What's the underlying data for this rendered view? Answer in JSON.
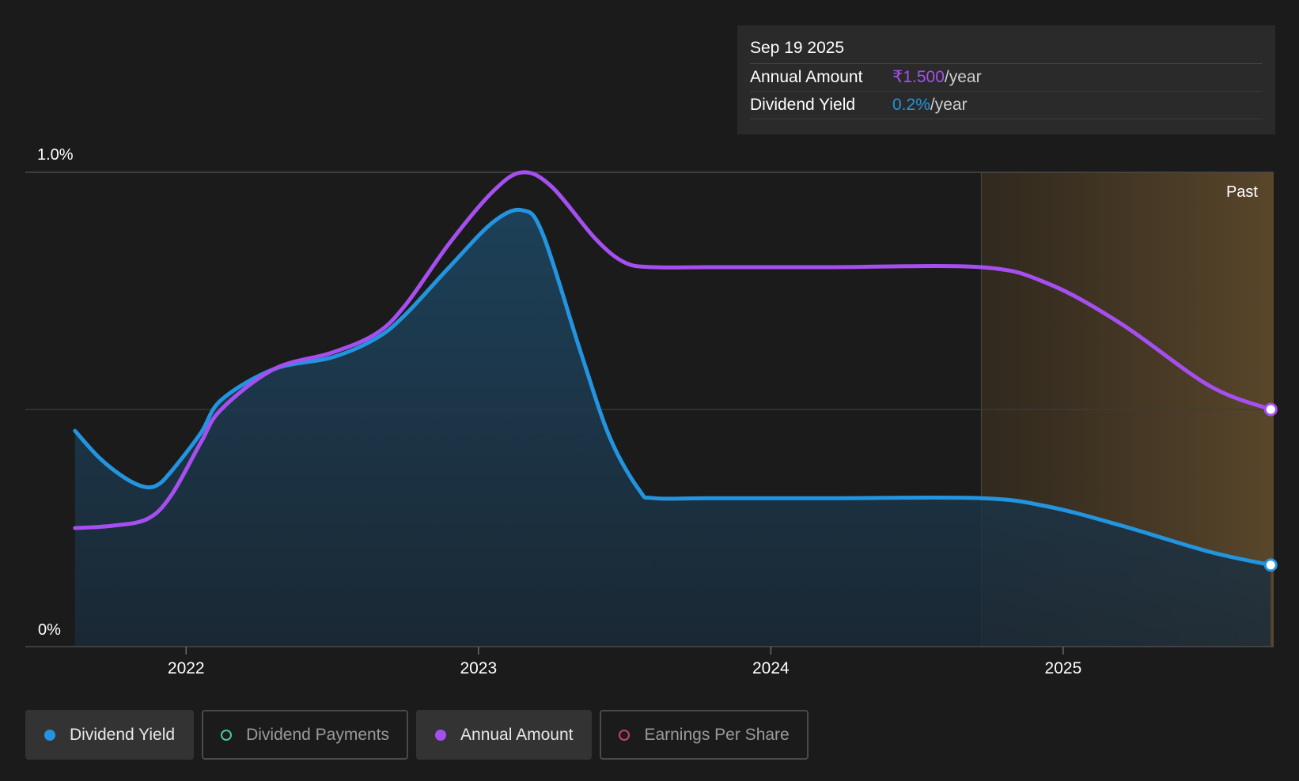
{
  "tooltip": {
    "date": "Sep 19 2025",
    "rows": [
      {
        "label": "Annual Amount",
        "value": "₹1.500",
        "suffix": "/year",
        "color": "#a64ff0"
      },
      {
        "label": "Dividend Yield",
        "value": "0.2%",
        "suffix": "/year",
        "color": "#2394df"
      }
    ]
  },
  "legend": [
    {
      "label": "Dividend Yield",
      "color": "#2394df",
      "active": true,
      "filled": true
    },
    {
      "label": "Dividend Payments",
      "color": "#4fc3a8",
      "active": false,
      "filled": false
    },
    {
      "label": "Annual Amount",
      "color": "#a64ff0",
      "active": true,
      "filled": true
    },
    {
      "label": "Earnings Per Share",
      "color": "#c2407a",
      "active": false,
      "filled": false
    }
  ],
  "chart_data": {
    "type": "line",
    "y_tick_labels": [
      "1.0%",
      "0%"
    ],
    "x_tick_labels": [
      "2022",
      "2023",
      "2024",
      "2025"
    ],
    "past_label": "Past",
    "ylim": [
      0,
      1.0
    ],
    "xlim": [
      2021.45,
      2025.72
    ],
    "grid": true,
    "forecast_start": 2024.72,
    "series": [
      {
        "name": "Dividend Yield",
        "color": "#2394df",
        "filled": true,
        "x": [
          2021.62,
          2021.7,
          2021.78,
          2021.85,
          2021.9,
          2021.95,
          2022.05,
          2022.12,
          2022.3,
          2022.5,
          2022.65,
          2022.75,
          2022.9,
          2023.05,
          2023.15,
          2023.22,
          2023.35,
          2023.45,
          2023.55,
          2023.6,
          2023.8,
          2024.2,
          2024.72,
          2024.95,
          2025.2,
          2025.5,
          2025.71
        ],
        "y": [
          0.455,
          0.4,
          0.36,
          0.338,
          0.34,
          0.37,
          0.45,
          0.52,
          0.585,
          0.61,
          0.65,
          0.7,
          0.8,
          0.895,
          0.92,
          0.87,
          0.62,
          0.44,
          0.33,
          0.313,
          0.313,
          0.313,
          0.313,
          0.295,
          0.255,
          0.2,
          0.172
        ]
      },
      {
        "name": "Annual Amount",
        "color": "#a64ff0",
        "filled": false,
        "x": [
          2021.62,
          2021.75,
          2021.87,
          2021.95,
          2022.05,
          2022.12,
          2022.3,
          2022.5,
          2022.65,
          2022.75,
          2022.9,
          2023.05,
          2023.15,
          2023.25,
          2023.4,
          2023.5,
          2023.6,
          2023.8,
          2024.2,
          2024.72,
          2024.95,
          2025.2,
          2025.5,
          2025.71
        ],
        "y": [
          0.25,
          0.255,
          0.27,
          0.32,
          0.43,
          0.5,
          0.585,
          0.62,
          0.66,
          0.72,
          0.85,
          0.96,
          1.0,
          0.97,
          0.86,
          0.81,
          0.8,
          0.8,
          0.8,
          0.8,
          0.765,
          0.68,
          0.55,
          0.5
        ]
      }
    ]
  }
}
